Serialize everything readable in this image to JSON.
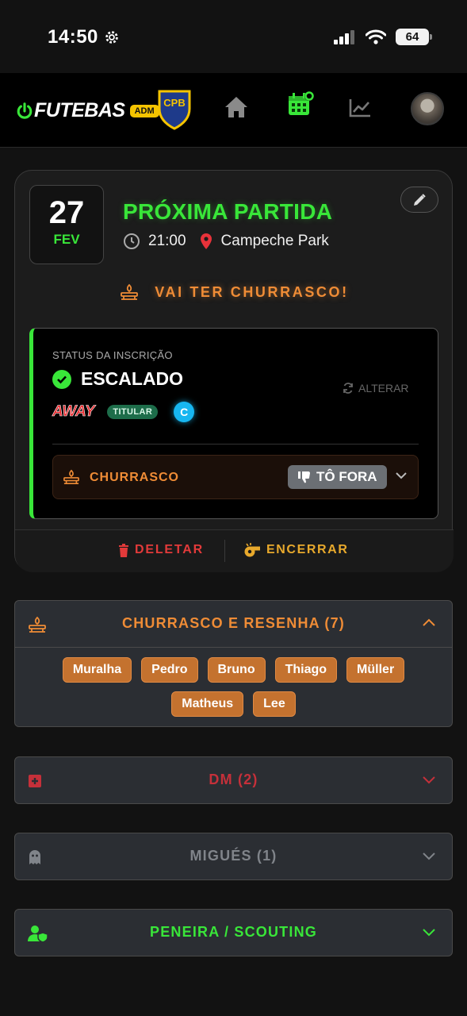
{
  "status_bar": {
    "time": "14:50",
    "battery": "64"
  },
  "header": {
    "logo": "FUTEBAS",
    "adm_badge": "ADM",
    "crest_text": "CPB",
    "nav": [
      "home-icon",
      "calendar-icon",
      "chart-icon"
    ],
    "accent": "#39e639"
  },
  "match": {
    "day": "27",
    "month": "FEV",
    "title": "PRÓXIMA PARTIDA",
    "time": "21:00",
    "location": "Campeche Park",
    "bbq_banner": "VAI TER CHURRASCO!"
  },
  "registration": {
    "label": "STATUS DA INSCRIÇÃO",
    "status": "ESCALADO",
    "change_label": "ALTERAR",
    "team": "AWAY",
    "role": "TITULAR",
    "captain": "C",
    "bbq_label": "CHURRASCO",
    "bbq_choice": "TÔ FORA"
  },
  "actions": {
    "delete": "DELETAR",
    "finish": "ENCERRAR"
  },
  "sections": {
    "bbq": {
      "title": "CHURRASCO E RESENHA (7)",
      "color": "#ef8c36",
      "players": [
        "Muralha",
        "Pedro",
        "Bruno",
        "Thiago",
        "Müller",
        "Matheus",
        "Lee"
      ]
    },
    "dm": {
      "title": "DM (2)",
      "color": "#c5303a"
    },
    "migues": {
      "title": "MIGUÉS (1)",
      "color": "#80848a"
    },
    "scouting": {
      "title": "PENEIRA / SCOUTING",
      "color": "#39e639"
    }
  }
}
